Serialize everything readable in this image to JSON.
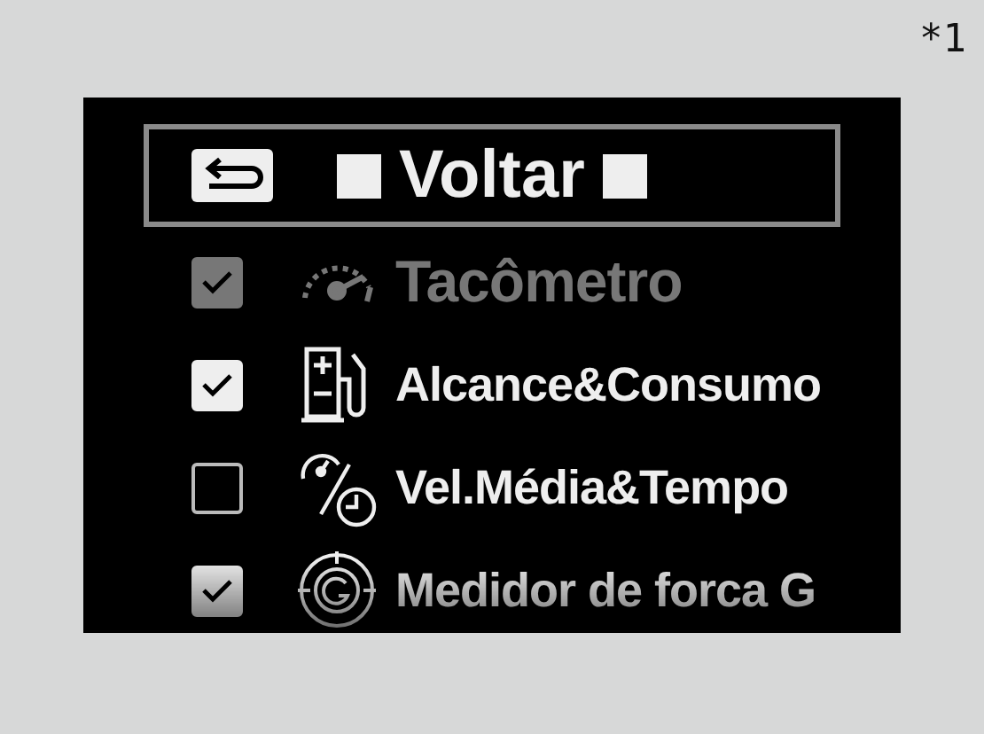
{
  "footnote": "*1",
  "back_item": {
    "label": "Voltar",
    "selected": true
  },
  "items": [
    {
      "label": "Tacômetro",
      "kind": "tachometer",
      "checked": true,
      "disabled": true
    },
    {
      "label": "Alcance&Consumo",
      "kind": "fuel",
      "checked": true,
      "disabled": false
    },
    {
      "label": "Vel.Média&Tempo",
      "kind": "speed-time",
      "checked": false,
      "disabled": false
    },
    {
      "label": "Medidor de forca G",
      "kind": "g-meter",
      "checked": true,
      "disabled": false
    }
  ]
}
